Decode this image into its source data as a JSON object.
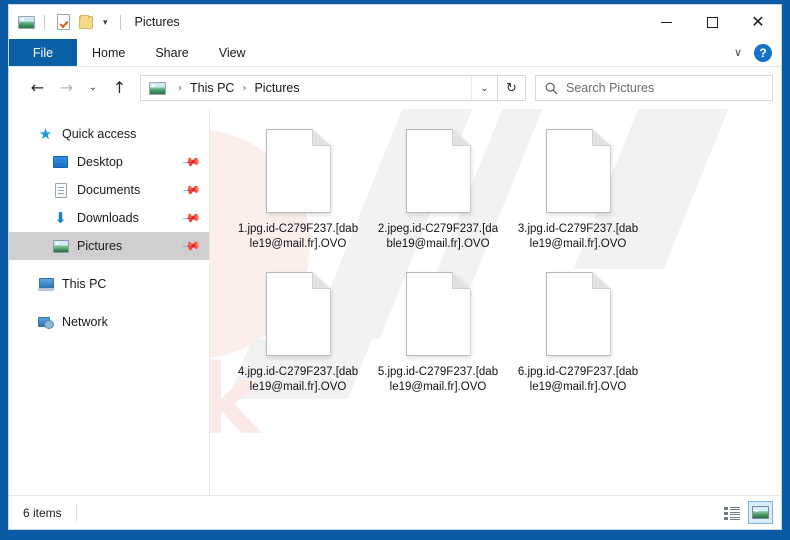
{
  "window": {
    "title": "Pictures",
    "quick_access_toolbar": [
      {
        "icon": "pictures-icon",
        "name": "qat-pictures"
      },
      {
        "icon": "properties-icon",
        "name": "qat-properties"
      },
      {
        "icon": "new-folder-icon",
        "name": "qat-new-folder"
      }
    ],
    "qat_dropdown_glyph": "▾",
    "controls": {
      "minimize": "—",
      "maximize": "□",
      "close": "✕"
    }
  },
  "ribbon": {
    "tabs": [
      {
        "label": "File",
        "active": true
      },
      {
        "label": "Home",
        "active": false
      },
      {
        "label": "Share",
        "active": false
      },
      {
        "label": "View",
        "active": false
      }
    ],
    "expand_glyph": "∨",
    "help_label": "?"
  },
  "navbar": {
    "back_glyph": "←",
    "forward_glyph": "→",
    "recent_glyph": "⌄",
    "up_glyph": "↑",
    "breadcrumbs": [
      {
        "label": "This PC"
      },
      {
        "label": "Pictures"
      }
    ],
    "breadcrumb_separator": "›",
    "address_dropdown_glyph": "⌄",
    "refresh_glyph": "↻"
  },
  "search": {
    "placeholder": "Search Pictures",
    "icon": "search-icon"
  },
  "sidebar": {
    "items": [
      {
        "label": "Quick access",
        "icon": "star-icon",
        "level": 0,
        "pinned": false,
        "selected": false
      },
      {
        "label": "Desktop",
        "icon": "desktop-icon",
        "level": 1,
        "pinned": true,
        "selected": false
      },
      {
        "label": "Documents",
        "icon": "documents-icon",
        "level": 1,
        "pinned": true,
        "selected": false
      },
      {
        "label": "Downloads",
        "icon": "downloads-icon",
        "level": 1,
        "pinned": true,
        "selected": false
      },
      {
        "label": "Pictures",
        "icon": "pictures-icon",
        "level": 1,
        "pinned": true,
        "selected": true
      },
      {
        "label": "This PC",
        "icon": "this-pc-icon",
        "level": 0,
        "pinned": false,
        "selected": false
      },
      {
        "label": "Network",
        "icon": "network-icon",
        "level": 0,
        "pinned": false,
        "selected": false
      }
    ],
    "pin_glyph": "✒"
  },
  "files": [
    {
      "name": "1.jpg.id-C279F237.[dable19@mail.fr].OVO",
      "icon": "generic-file-icon"
    },
    {
      "name": "2.jpeg.id-C279F237.[dable19@mail.fr].OVO",
      "icon": "generic-file-icon"
    },
    {
      "name": "3.jpg.id-C279F237.[dable19@mail.fr].OVO",
      "icon": "generic-file-icon"
    },
    {
      "name": "4.jpg.id-C279F237.[dable19@mail.fr].OVO",
      "icon": "generic-file-icon"
    },
    {
      "name": "5.jpg.id-C279F237.[dable19@mail.fr].OVO",
      "icon": "generic-file-icon"
    },
    {
      "name": "6.jpg.id-C279F237.[dable19@mail.fr].OVO",
      "icon": "generic-file-icon"
    }
  ],
  "statusbar": {
    "item_count": "6 items",
    "views": [
      {
        "name": "details-view",
        "active": false
      },
      {
        "name": "large-icons-view",
        "active": true
      }
    ]
  },
  "watermark": {
    "text": "risk",
    "color": "#fae9e6"
  },
  "colors": {
    "accent": "#0b5fa5",
    "frame": "#0a5ba3",
    "selection": "#cfcfcf",
    "help": "#1473c8"
  }
}
